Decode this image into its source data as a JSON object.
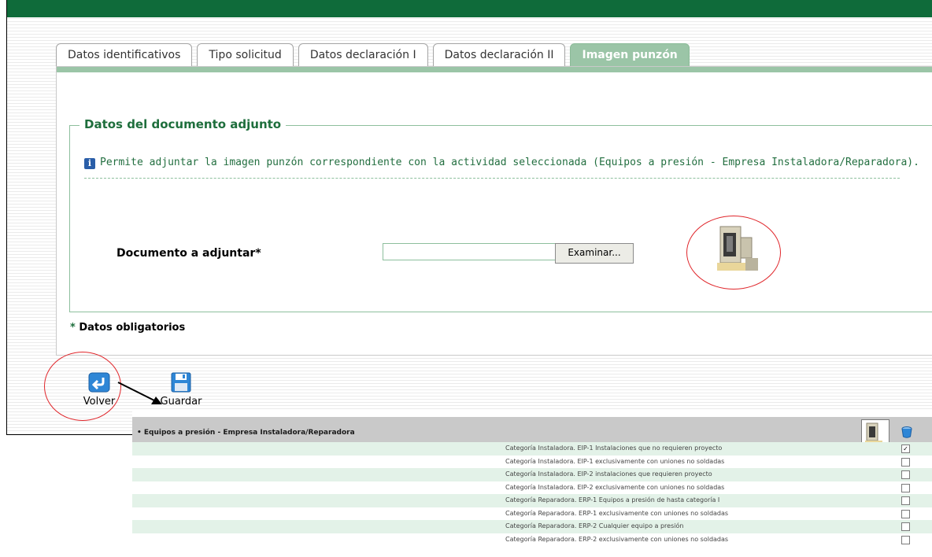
{
  "tabs": [
    {
      "label": "Datos identificativos",
      "active": false
    },
    {
      "label": "Tipo solicitud",
      "active": false
    },
    {
      "label": "Datos declaración I",
      "active": false
    },
    {
      "label": "Datos declaración II",
      "active": false
    },
    {
      "label": "Imagen punzón",
      "active": true
    }
  ],
  "section": {
    "legend": "Datos del documento adjunto",
    "info_text": "Permite adjuntar la imagen punzón correspondiente con la actividad seleccionada (Equipos a presión - Empresa Instaladora/Reparadora).",
    "info_icon": "i"
  },
  "form": {
    "document_label": "Documento a adjuntar",
    "required_mark": "*",
    "document_value": "",
    "browse_label": "Examinar..."
  },
  "required_note": {
    "mark": "*",
    "text": "Datos obligatorios"
  },
  "actions": {
    "back_label": "Volver",
    "save_label": "Guardar"
  },
  "overlay_table": {
    "title": "Equipos a presión - Empresa Instaladora/Reparadora",
    "rows": [
      {
        "label": "Categoría Instaladora. EIP-1 Instalaciones que no requieren proyecto",
        "checked": true,
        "check_mark": "✓"
      },
      {
        "label": "Categoría Instaladora. EIP-1 exclusivamente con uniones no soldadas",
        "checked": false,
        "check_mark": ""
      },
      {
        "label": "Categoría Instaladora. EIP-2 instalaciones que requieren proyecto",
        "checked": false,
        "check_mark": ""
      },
      {
        "label": "Categoría Instaladora. EIP-2 exclusivamente con uniones no soldadas",
        "checked": false,
        "check_mark": ""
      },
      {
        "label": "Categoría Reparadora. ERP-1 Equipos a presión de hasta categoría I",
        "checked": false,
        "check_mark": ""
      },
      {
        "label": "Categoría Reparadora. ERP-1 exclusivamente con uniones no soldadas",
        "checked": false,
        "check_mark": ""
      },
      {
        "label": "Categoría Reparadora. ERP-2 Cualquier equipo a presión",
        "checked": false,
        "check_mark": ""
      },
      {
        "label": "Categoría Reparadora. ERP-2 exclusivamente con uniones no soldadas",
        "checked": false,
        "check_mark": ""
      }
    ]
  },
  "colors": {
    "brand_green": "#0f6b3a",
    "tab_active": "#9bc5a7",
    "legend_text": "#1e6e3c",
    "annotation_circle": "#e0262b"
  }
}
